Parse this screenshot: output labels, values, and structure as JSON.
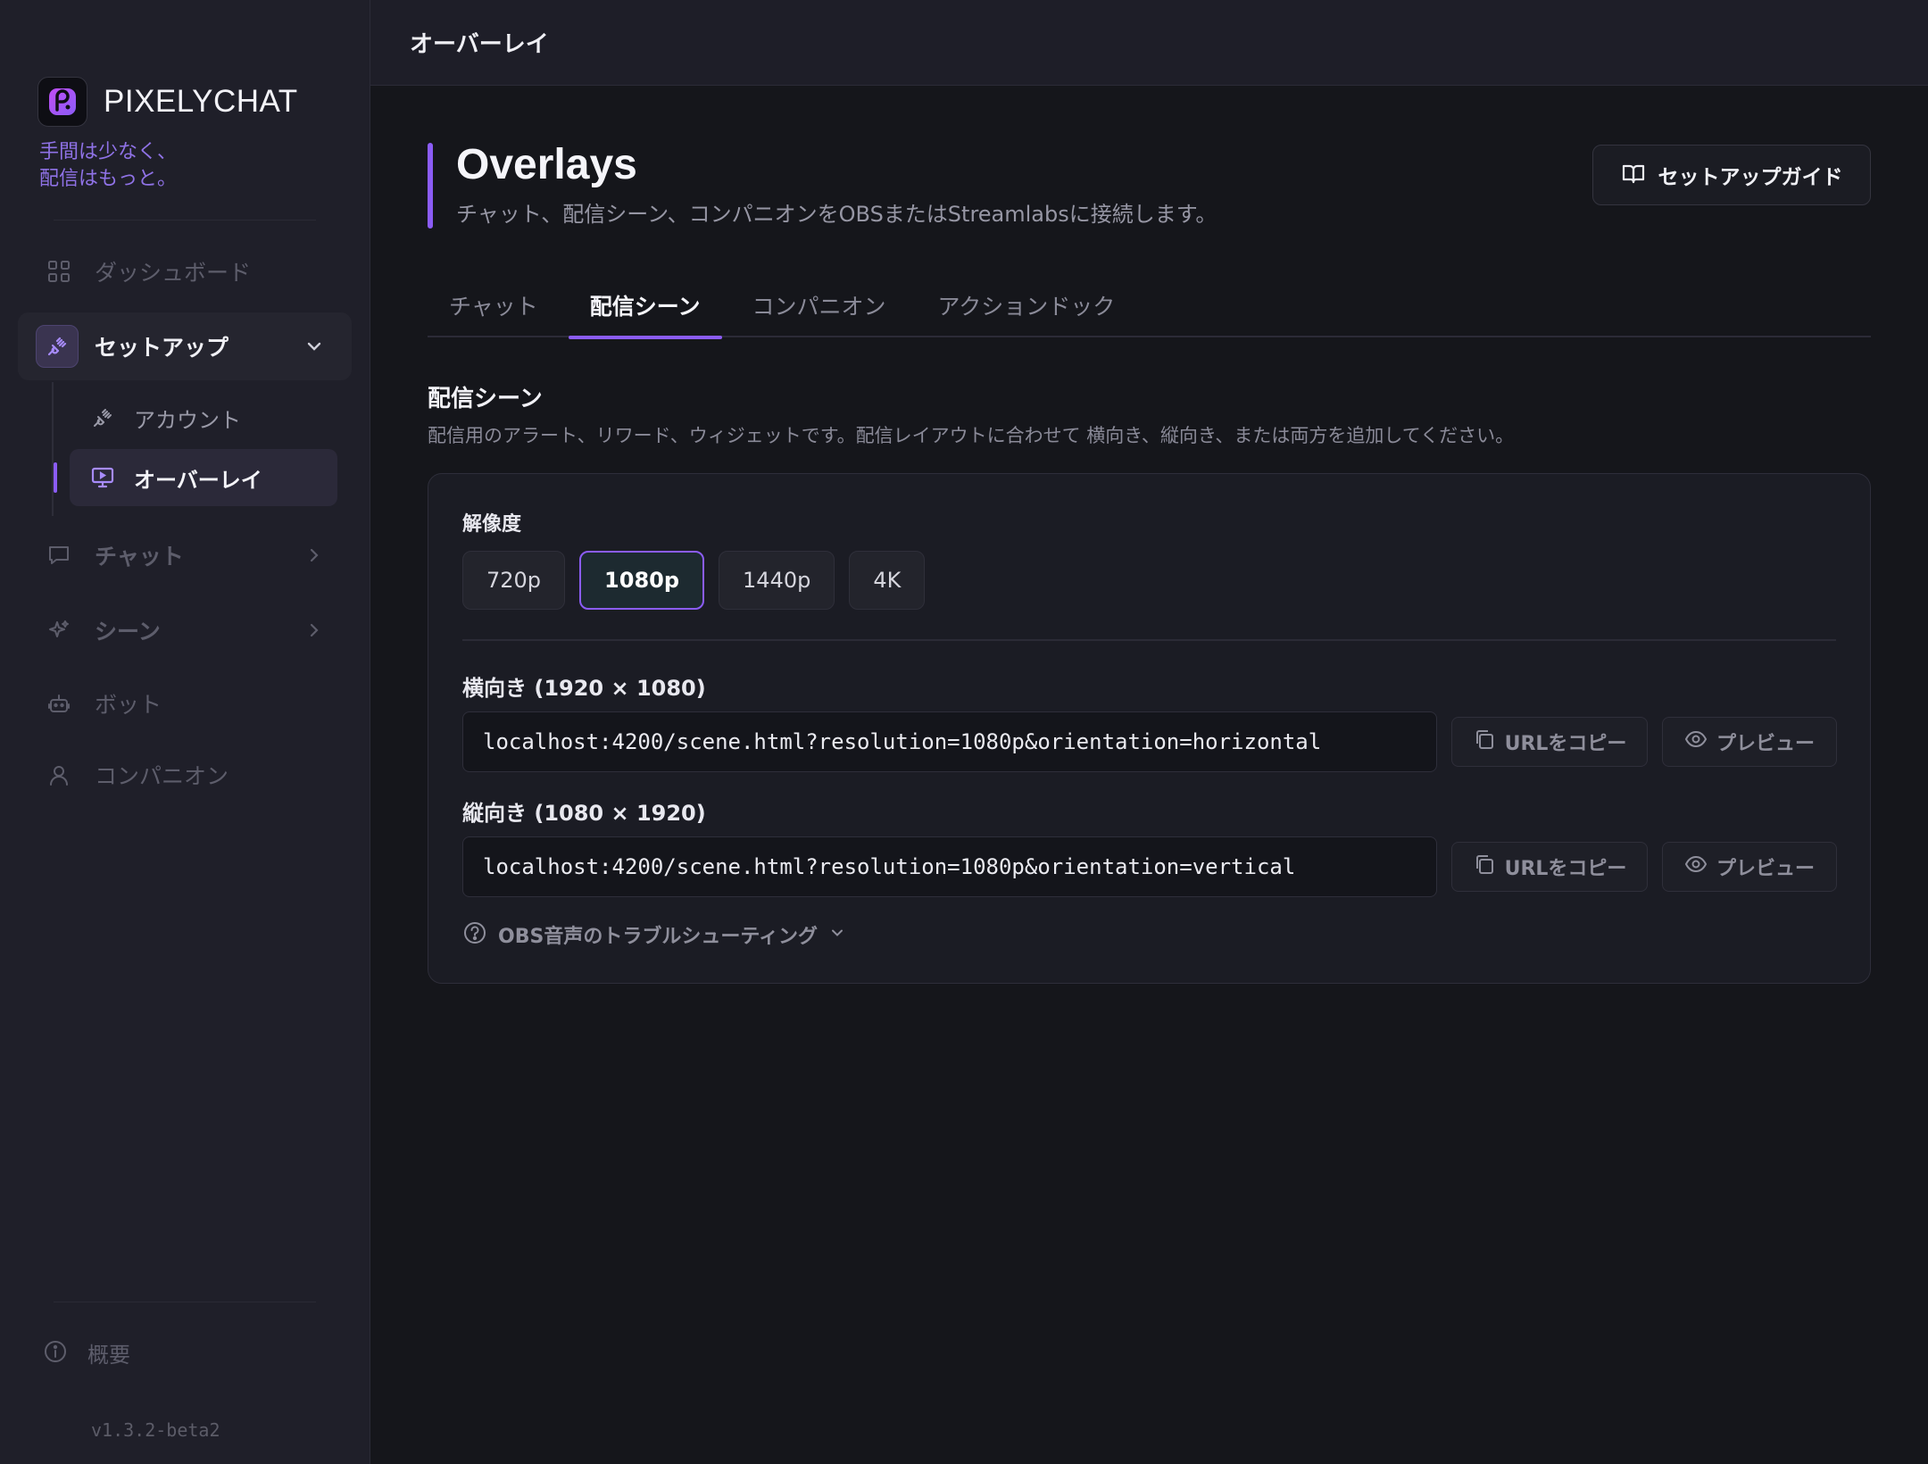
{
  "brand": {
    "name": "PIXELYCHAT",
    "tagline_1": "手間は少なく、",
    "tagline_2": "配信はもっと。"
  },
  "colors": {
    "accent": "#8b5cf6",
    "background": "#15161b",
    "sidebar": "#1f1f29"
  },
  "sidebar": {
    "dashboard": "ダッシュボード",
    "setup": "セットアップ",
    "account": "アカウント",
    "overlays": "オーバーレイ",
    "chat": "チャット",
    "scenes": "シーン",
    "bot": "ボット",
    "companion": "コンパニオン",
    "about": "概要",
    "version": "v1.3.2-beta2"
  },
  "topbar": {
    "title": "オーバーレイ"
  },
  "header": {
    "title": "Overlays",
    "subtitle": "チャット、配信シーン、コンパニオンをOBSまたはStreamlabsに接続します。",
    "guide_button": "セットアップガイド"
  },
  "tabs": [
    {
      "label": "チャット",
      "active": false
    },
    {
      "label": "配信シーン",
      "active": true
    },
    {
      "label": "コンパニオン",
      "active": false
    },
    {
      "label": "アクションドック",
      "active": false
    }
  ],
  "section": {
    "title": "配信シーン",
    "description": "配信用のアラート、リワード、ウィジェットです。配信レイアウトに合わせて 横向き、縦向き、または両方を追加してください。"
  },
  "resolution": {
    "label": "解像度",
    "options": [
      "720p",
      "1080p",
      "1440p",
      "4K"
    ],
    "selected": "1080p"
  },
  "horizontal": {
    "label": "横向き (1920 × 1080)",
    "url": "localhost:4200/scene.html?resolution=1080p&orientation=horizontal",
    "copy_label": "URLをコピー",
    "preview_label": "プレビュー"
  },
  "vertical": {
    "label": "縦向き (1080 × 1920)",
    "url": "localhost:4200/scene.html?resolution=1080p&orientation=vertical",
    "copy_label": "URLをコピー",
    "preview_label": "プレビュー"
  },
  "troubleshooting": {
    "label": "OBS音声のトラブルシューティング"
  },
  "icons": [
    "logo-icon",
    "grid-icon",
    "plug-icon",
    "chevron-down-icon",
    "chevron-right-icon",
    "monitor-icon",
    "chat-bubble-icon",
    "sparkle-icon",
    "bot-icon",
    "user-icon",
    "info-icon",
    "book-icon",
    "copy-icon",
    "eye-icon",
    "help-circle-icon"
  ]
}
